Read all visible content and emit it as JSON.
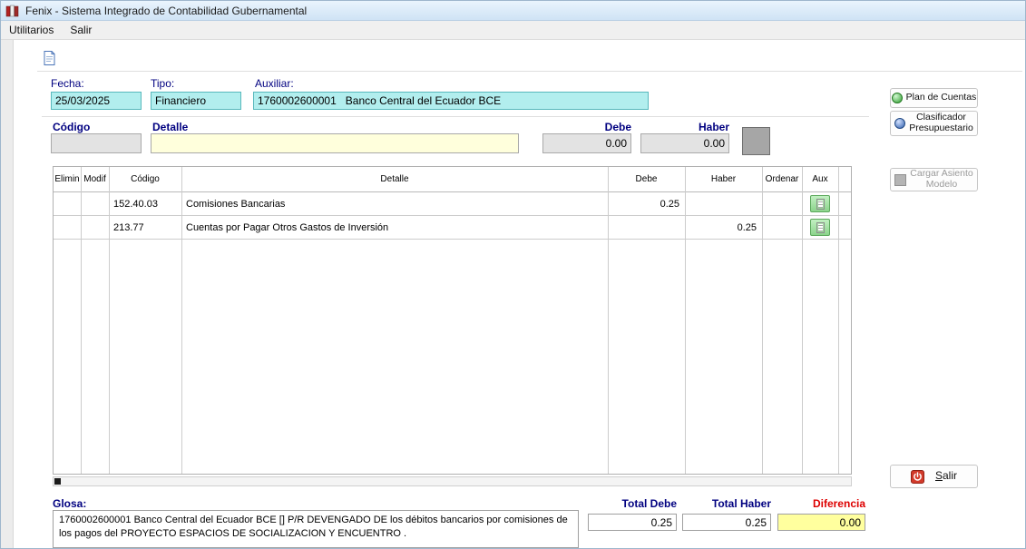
{
  "window": {
    "title": "Fenix - Sistema Integrado de Contabilidad Gubernamental"
  },
  "menubar": {
    "items": [
      {
        "label": "Utilitarios"
      },
      {
        "label": "Salir"
      }
    ]
  },
  "header_form": {
    "fecha_label": "Fecha:",
    "fecha_value": "25/03/2025",
    "tipo_label": "Tipo:",
    "tipo_value": "Financiero",
    "auxiliar_label": "Auxiliar:",
    "auxiliar_value": "1760002600001   Banco Central del Ecuador BCE"
  },
  "entry_row": {
    "codigo_label": "Código",
    "detalle_label": "Detalle",
    "debe_label": "Debe",
    "haber_label": "Haber",
    "codigo_value": "",
    "detalle_value": "",
    "debe_value": "0.00",
    "haber_value": "0.00"
  },
  "side_panel": {
    "plan_de_cuentas_label": "Plan de Cuentas",
    "clasificador_line1": "Clasificador",
    "clasificador_line2": "Presupuestario",
    "cargar_line1": "Cargar Asiento",
    "cargar_line2": "Modelo",
    "salir_mnemonic": "S",
    "salir_rest": "alir"
  },
  "grid": {
    "headers": [
      "Elimin",
      "Modif",
      "Código",
      "Detalle",
      "Debe",
      "Haber",
      "Ordenar",
      "Aux"
    ],
    "rows": [
      {
        "elimin": "",
        "modif": "",
        "codigo": "152.40.03",
        "detalle": "Comisiones Bancarias",
        "debe": "0.25",
        "haber": "",
        "ordenar": ""
      },
      {
        "elimin": "",
        "modif": "",
        "codigo": "213.77",
        "detalle": "Cuentas por Pagar Otros Gastos de Inversión",
        "debe": "",
        "haber": "0.25",
        "ordenar": ""
      }
    ]
  },
  "footer": {
    "glosa_label": "Glosa:",
    "glosa_text": "1760002600001 Banco Central del Ecuador BCE  [] P/R DEVENGADO DE los débitos bancarios por comisiones de los pagos del PROYECTO ESPACIOS DE SOCIALIZACION Y ENCUENTRO .",
    "total_debe_label": "Total Debe",
    "total_debe_value": "0.25",
    "total_haber_label": "Total Haber",
    "total_haber_value": "0.25",
    "diferencia_label": "Diferencia",
    "diferencia_value": "0.00"
  },
  "colors": {
    "field_cyan": "#b2eeee",
    "field_yellow": "#ffffdc",
    "diferencia_yellow": "#ffff9e",
    "label_navy": "#000080",
    "label_red": "#dd0000",
    "aux_green": "#8bd48b"
  }
}
